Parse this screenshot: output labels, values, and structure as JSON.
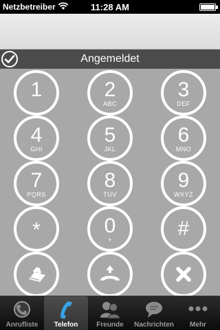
{
  "status_bar": {
    "carrier": "Netzbetreiber",
    "time": "11:28 AM",
    "battery_level": 1.0
  },
  "login": {
    "status": "Angemeldet"
  },
  "keypad": {
    "keys": [
      {
        "digit": "1",
        "letters": ""
      },
      {
        "digit": "2",
        "letters": "ABC"
      },
      {
        "digit": "3",
        "letters": "DEF"
      },
      {
        "digit": "4",
        "letters": "GHI"
      },
      {
        "digit": "5",
        "letters": "JKL"
      },
      {
        "digit": "6",
        "letters": "MNO"
      },
      {
        "digit": "7",
        "letters": "PQRS"
      },
      {
        "digit": "8",
        "letters": "TUV"
      },
      {
        "digit": "9",
        "letters": "WXYZ"
      },
      {
        "digit": "*",
        "letters": ""
      },
      {
        "digit": "0",
        "letters": "+"
      },
      {
        "digit": "#",
        "letters": ""
      }
    ]
  },
  "tabs": [
    {
      "label": "Anrufliste",
      "icon": "call-history-icon"
    },
    {
      "label": "Telefon",
      "icon": "phone-icon",
      "selected": true
    },
    {
      "label": "Freunde",
      "icon": "friends-icon"
    },
    {
      "label": "Nachrichten",
      "icon": "messages-icon"
    },
    {
      "label": "Mehr",
      "icon": "more-icon"
    }
  ],
  "colors": {
    "accent": "#36a2e6",
    "keypad_bg": "#a8a8a8",
    "bar": "#4b4b4b"
  }
}
